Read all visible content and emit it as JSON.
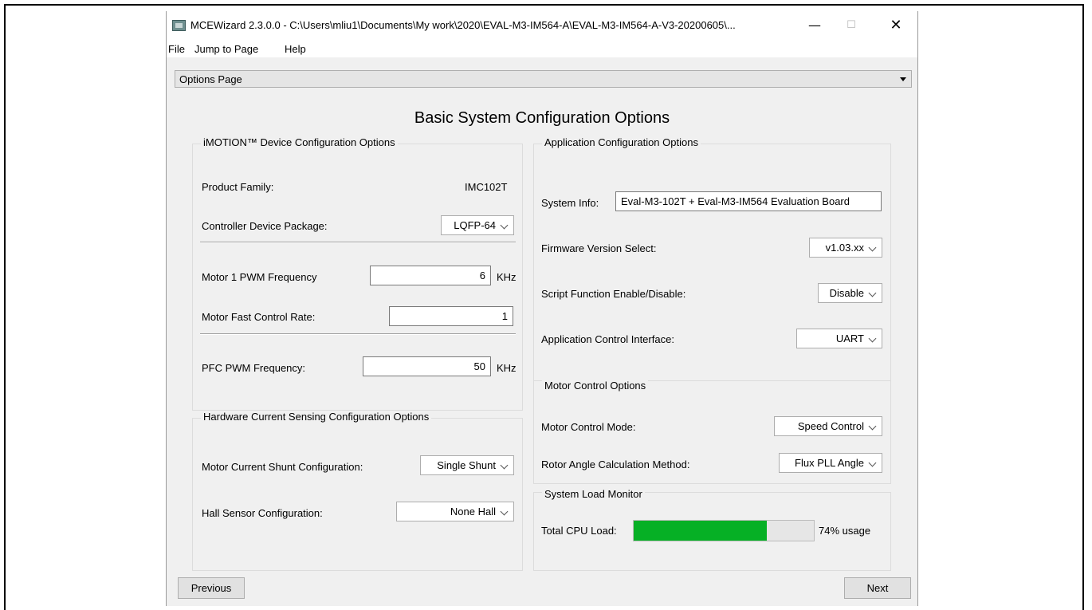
{
  "window": {
    "title": "MCEWizard 2.3.0.0  - C:\\Users\\mliu1\\Documents\\My work\\2020\\EVAL-M3-IM564-A\\EVAL-M3-IM564-A-V3-20200605\\...",
    "minimize_glyph": "—",
    "maximize_glyph": "☐",
    "close_glyph": "✕"
  },
  "menu": {
    "file": "File",
    "jump": "Jump to Page",
    "help": "Help"
  },
  "page_selector": {
    "value": "Options Page"
  },
  "page_title": "Basic System Configuration Options",
  "device_group": {
    "title": "iMOTION™ Device Configuration Options",
    "product_family_label": "Product Family:",
    "product_family_value": "IMC102T",
    "package_label": "Controller Device Package:",
    "package_value": "LQFP-64",
    "pwm_label": "Motor 1 PWM Frequency",
    "pwm_value": "6",
    "pwm_unit": "KHz",
    "fast_rate_label": "Motor Fast Control Rate:",
    "fast_rate_value": "1",
    "pfc_label": "PFC PWM Frequency:",
    "pfc_value": "50",
    "pfc_unit": "KHz"
  },
  "sensing_group": {
    "title": "Hardware Current Sensing Configuration Options",
    "shunt_label": "Motor Current Shunt Configuration:",
    "shunt_value": "Single Shunt",
    "hall_label": "Hall Sensor Configuration:",
    "hall_value": "None Hall"
  },
  "app_group": {
    "title": "Application Configuration Options",
    "system_info_label": "System Info:",
    "system_info_value": "Eval-M3-102T + Eval-M3-IM564 Evaluation Board",
    "firmware_label": "Firmware Version Select:",
    "firmware_value": "v1.03.xx",
    "script_label": "Script Function Enable/Disable:",
    "script_value": "Disable",
    "interface_label": "Application Control Interface:",
    "interface_value": "UART"
  },
  "motor_group": {
    "title": "Motor Control Options",
    "mode_label": "Motor Control Mode:",
    "mode_value": "Speed Control",
    "angle_label": "Rotor Angle Calculation Method:",
    "angle_value": "Flux PLL Angle"
  },
  "load_group": {
    "title": "System Load Monitor",
    "cpu_label": "Total CPU Load:",
    "cpu_percent": 74,
    "cpu_text": "74% usage",
    "bar_color": "#06b025"
  },
  "nav": {
    "previous": "Previous",
    "next": "Next"
  }
}
